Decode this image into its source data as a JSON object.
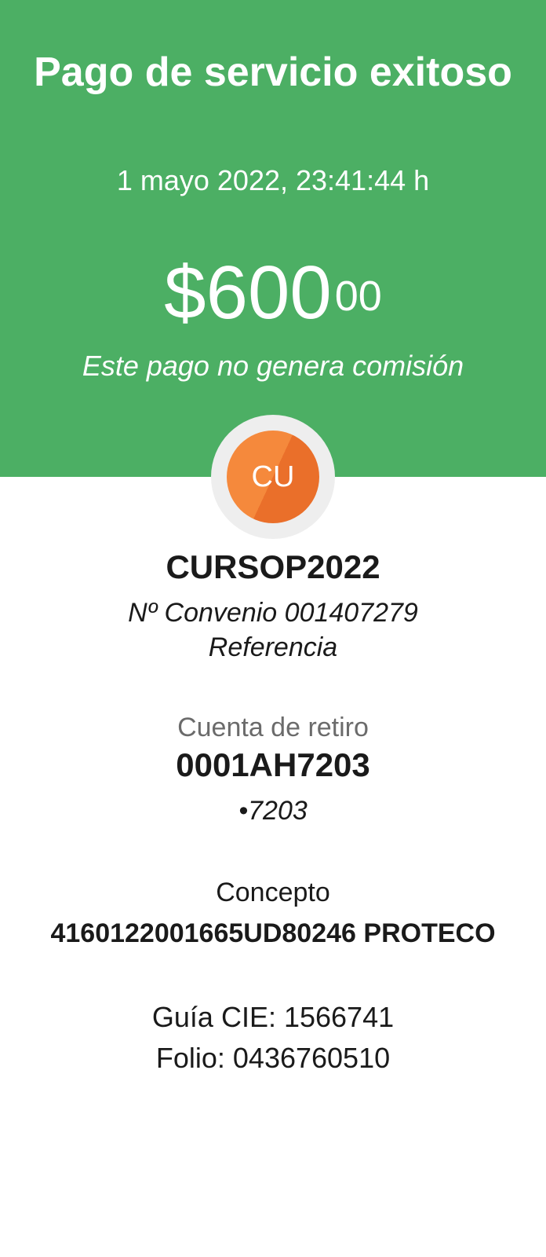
{
  "header": {
    "title": "Pago de servicio exitoso",
    "datetime": "1 mayo 2022, 23:41:44 h",
    "amount_main": "$600",
    "amount_cents": "00",
    "commission_note": "Este pago no genera comisión",
    "background_color": "#4caf64"
  },
  "merchant": {
    "avatar_initials": "CU",
    "avatar_color": "#f5893c",
    "name": "CURSOP2022",
    "convenio": "Nº Convenio 001407279",
    "referencia": "Referencia"
  },
  "account": {
    "label": "Cuenta de retiro",
    "number": "0001AH7203",
    "masked": "•7203"
  },
  "concept": {
    "label": "Concepto",
    "value": "4160122001665UD80246 PROTECO"
  },
  "details": {
    "guia_cie": "Guía CIE: 1566741",
    "folio": "Folio: 0436760510"
  }
}
